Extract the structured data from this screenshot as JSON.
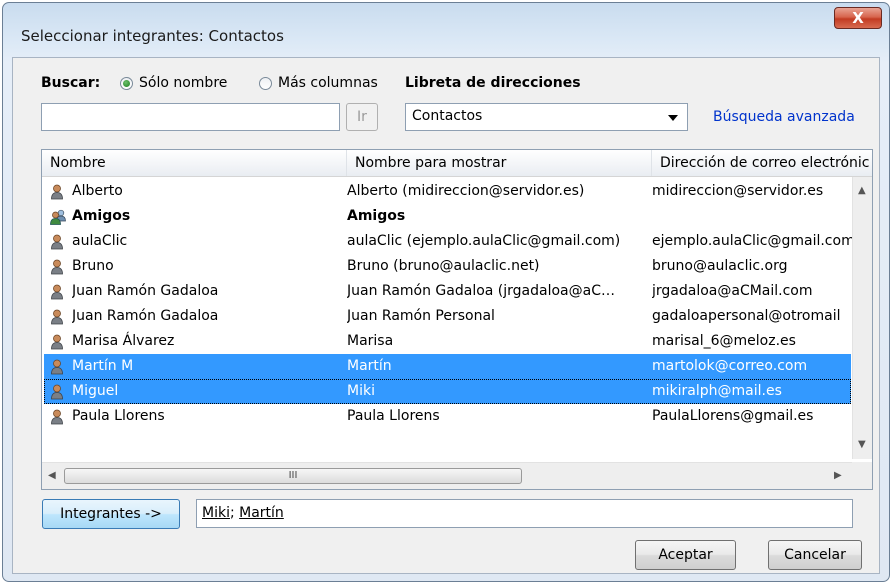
{
  "window": {
    "title": "Seleccionar integrantes: Contactos",
    "close_label": "X"
  },
  "search": {
    "label": "Buscar:",
    "option_name_only": "Sólo nombre",
    "option_more_columns": "Más columnas",
    "selected_option": "Sólo nombre",
    "input_value": "",
    "go_button": "Ir"
  },
  "address_book": {
    "label": "Libreta de direcciones",
    "selected": "Contactos",
    "advanced_search": "Búsqueda avanzada"
  },
  "columns": [
    "Nombre",
    "Nombre para mostrar",
    "Dirección de correo electrónic"
  ],
  "rows": [
    {
      "name": "Alberto",
      "display": "Alberto (midireccion@servidor.es)",
      "email": "midireccion@servidor.es",
      "icon": "contact-icon",
      "selected": false,
      "bold": false
    },
    {
      "name": "Amigos",
      "display": "Amigos",
      "email": "",
      "icon": "group-icon",
      "selected": false,
      "bold": true
    },
    {
      "name": "aulaClic",
      "display": "aulaClic (ejemplo.aulaClic@gmail.com)",
      "email": "ejemplo.aulaClic@gmail.com",
      "icon": "contact-icon",
      "selected": false,
      "bold": false
    },
    {
      "name": "Bruno",
      "display": "Bruno (bruno@aulaclic.net)",
      "email": "bruno@aulaclic.org",
      "icon": "contact-icon",
      "selected": false,
      "bold": false
    },
    {
      "name": "Juan Ramón Gadaloa",
      "display": "Juan Ramón Gadaloa (jrgadaloa@aC…",
      "email": "jrgadaloa@aCMail.com",
      "icon": "contact-icon",
      "selected": false,
      "bold": false
    },
    {
      "name": "Juan Ramón Gadaloa",
      "display": "Juan Ramón Personal",
      "email": "gadaloapersonal@otromail",
      "icon": "contact-icon",
      "selected": false,
      "bold": false
    },
    {
      "name": "Marisa Álvarez",
      "display": "Marisa",
      "email": "marisal_6@meloz.es",
      "icon": "contact-icon",
      "selected": false,
      "bold": false
    },
    {
      "name": "Martín M",
      "display": "Martín",
      "email": "martolok@correo.com",
      "icon": "contact-icon",
      "selected": true,
      "bold": false
    },
    {
      "name": "Miguel",
      "display": "Miki",
      "email": "mikiralph@mail.es",
      "icon": "contact-icon",
      "selected": true,
      "bold": false
    },
    {
      "name": "Paula Llorens",
      "display": "Paula Llorens",
      "email": "PaulaLlorens@gmail.es",
      "icon": "contact-icon",
      "selected": false,
      "bold": false
    }
  ],
  "hscroll_grip": "III",
  "members": {
    "button": "Integrantes ->",
    "values": [
      "Miki",
      "Martín"
    ],
    "separator": "; "
  },
  "buttons": {
    "ok": "Aceptar",
    "cancel": "Cancelar"
  },
  "colors": {
    "selection": "#3399ff",
    "link": "#0033cc"
  }
}
